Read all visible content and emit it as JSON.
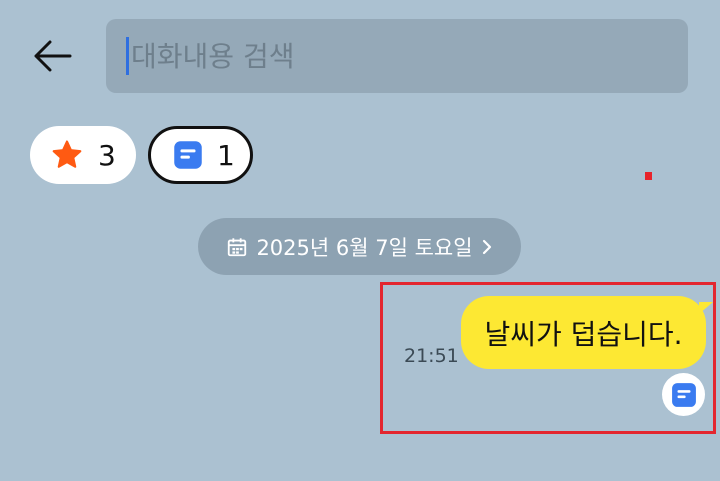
{
  "search": {
    "placeholder": "대화내용 검색",
    "value": ""
  },
  "filters": {
    "star": {
      "icon": "star-icon",
      "count": "3",
      "color": "#ff5a12"
    },
    "note": {
      "icon": "note-icon",
      "count": "1",
      "color": "#3a7bf0"
    }
  },
  "date_divider": {
    "icon": "calendar-icon",
    "label": "2025년 6월 7일 토요일",
    "chevron": "chevron-right-icon"
  },
  "message": {
    "text": "날씨가 덥습니다.",
    "time": "21:51",
    "bubble_color": "#fde833",
    "badge_icon": "note-icon"
  },
  "colors": {
    "background": "#abc1d1",
    "highlight": "#e3262f"
  }
}
